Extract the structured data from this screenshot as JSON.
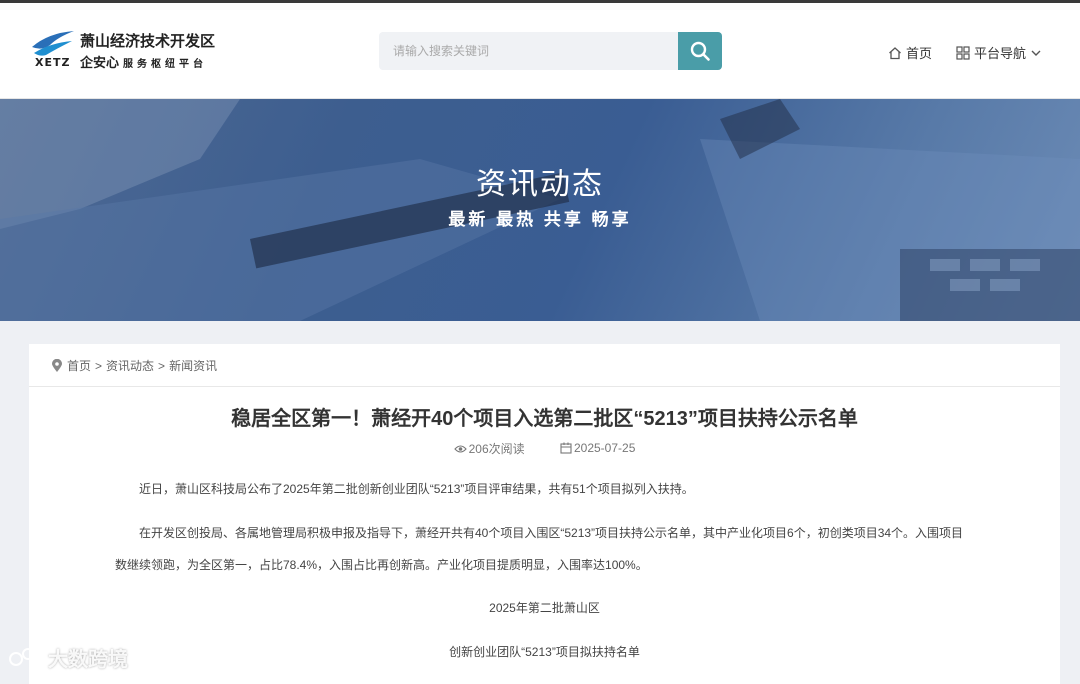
{
  "header": {
    "logo_abbr": "XETZ",
    "logo_title": "萧山经济技术开发区",
    "logo_sub": "企安心",
    "logo_sub_small": "服务枢纽平台",
    "search_placeholder": "请输入搜索关键词",
    "nav_home": "首页",
    "nav_platform": "平台导航"
  },
  "banner": {
    "title": "资讯动态",
    "subtitle": "最新 最热 共享 畅享"
  },
  "breadcrumb": {
    "items": [
      "首页",
      "资讯动态",
      "新闻资讯"
    ],
    "separator": ">"
  },
  "article": {
    "title": "稳居全区第一！萧经开40个项目入选第二批区“5213”项目扶持公示名单",
    "views": "206次阅读",
    "date": "2025-07-25",
    "p1": "近日，萧山区科技局公布了2025年第二批创新创业团队“5213”项目评审结果，共有51个项目拟列入扶持。",
    "p2a": "在开发区创投局、各属地管理局积极申报及指导下，萧经开共有40个项目入围区“5213”项目扶持公示名单，其中产业化项目6个，初创类项目34个。入围项目",
    "p2b": "数继续领跑，为全区第一，占比78.4%，入围占比再创新高。产业化项目提质明显，入围率达100%。",
    "p3": "2025年第二批萧山区",
    "p4": "创新创业团队“5213”项目拟扶持名单"
  },
  "watermark": "大数跨境",
  "colors": {
    "accent": "#4a9da8",
    "banner": "#3d5e8f",
    "background": "#eef0f4"
  }
}
